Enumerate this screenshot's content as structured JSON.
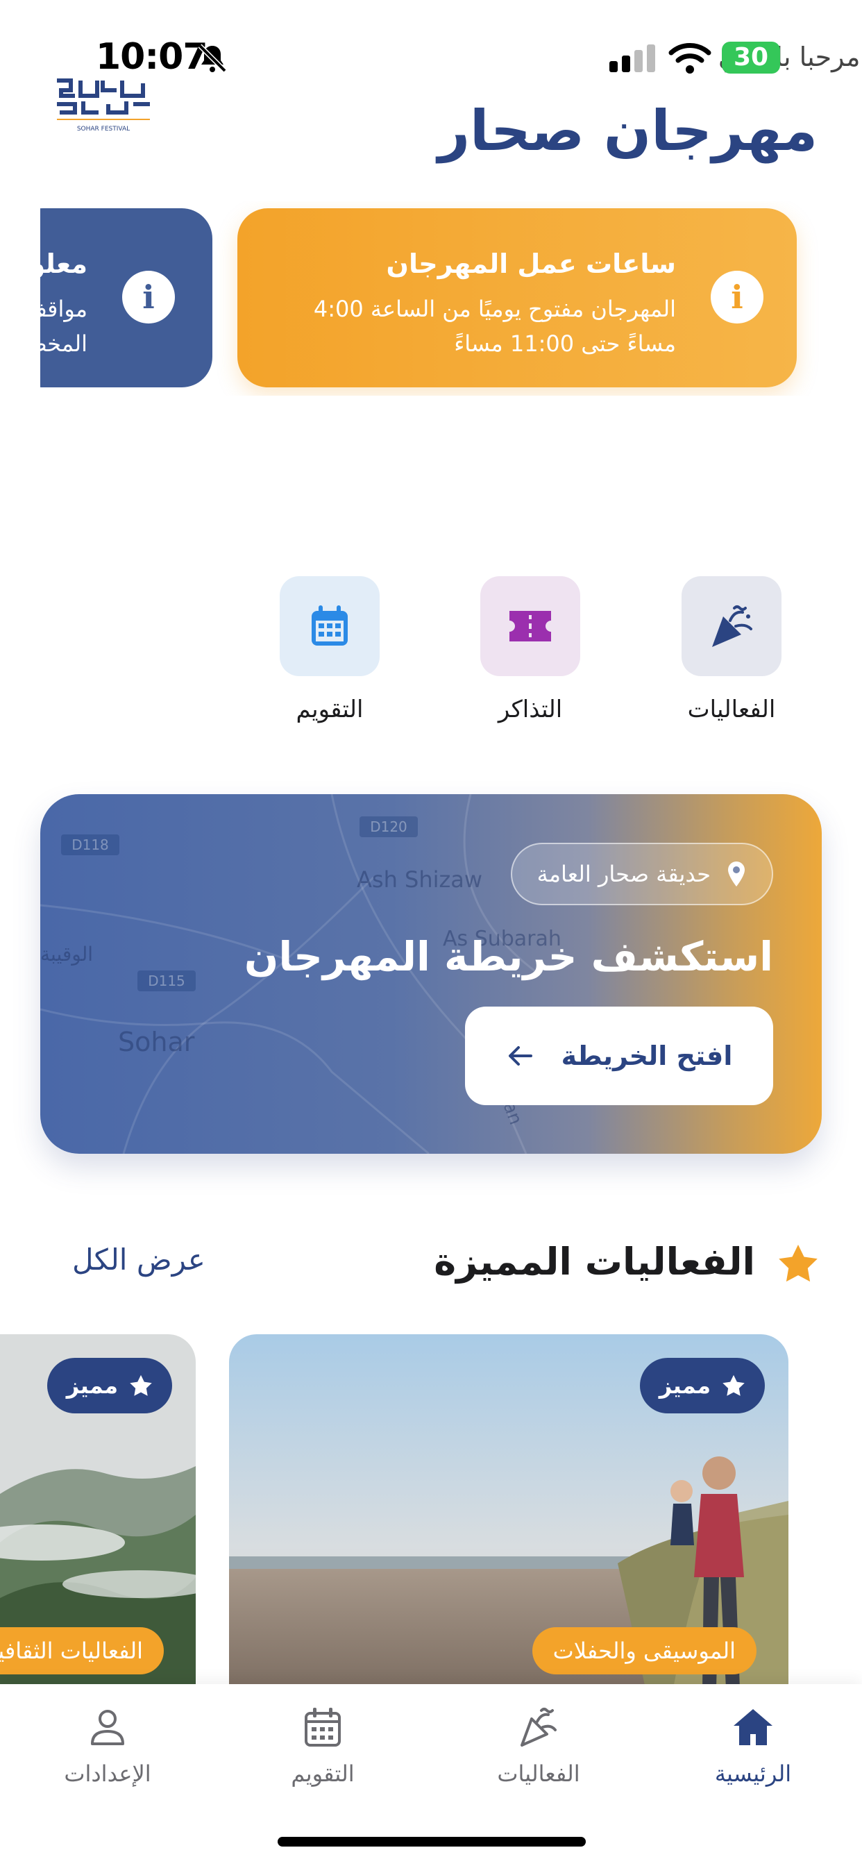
{
  "status_bar": {
    "time": "10:07",
    "battery": "30",
    "greeting_overlay": "مرحبا بك في"
  },
  "header": {
    "title": "مهرجان صحار",
    "logo_text": "SOHAR FESTIVAL"
  },
  "info_cards": [
    {
      "title": "ساعات عمل المهرجان",
      "line1": "المهرجان مفتوح يوميًا من الساعة 4:00",
      "line2": "مساءً حتى 11:00 مساءً",
      "icon": "info-icon"
    },
    {
      "title": "معلومات",
      "line1": "مواقف",
      "line2": "المخصصة",
      "icon": "info-icon"
    }
  ],
  "quick_actions": [
    {
      "label": "الفعاليات",
      "icon": "party-popper-icon"
    },
    {
      "label": "التذاكر",
      "icon": "ticket-icon"
    },
    {
      "label": "التقويم",
      "icon": "calendar-icon"
    }
  ],
  "map_card": {
    "location": "حديقة صحار العامة",
    "title": "استكشف خريطة المهرجان",
    "button": "افتح الخريطة",
    "map_labels": {
      "d118": "D118",
      "d120": "D120",
      "d115": "D115",
      "ash_shizaw": "Ash Shizaw",
      "as_subarah": "As Subarah",
      "sohar": "Sohar",
      "alwaqibah": "الوقيبة",
      "sultan": "Sultan"
    }
  },
  "featured": {
    "title": "الفعاليات المميزة",
    "view_all": "عرض الكل",
    "events": [
      {
        "badge": "مميز",
        "category": "الموسيقى والحفلات"
      },
      {
        "badge": "مميز",
        "category": "الفعاليات الثقافية"
      }
    ]
  },
  "bottom_nav": [
    {
      "label": "الرئيسية",
      "icon": "home-icon",
      "active": true
    },
    {
      "label": "الفعاليات",
      "icon": "party-popper-icon",
      "active": false
    },
    {
      "label": "التقويم",
      "icon": "calendar-icon",
      "active": false
    },
    {
      "label": "الإعدادات",
      "icon": "person-icon",
      "active": false
    }
  ],
  "colors": {
    "primary": "#2b4482",
    "accent": "#f3a32a",
    "card_blue": "#415d97"
  }
}
